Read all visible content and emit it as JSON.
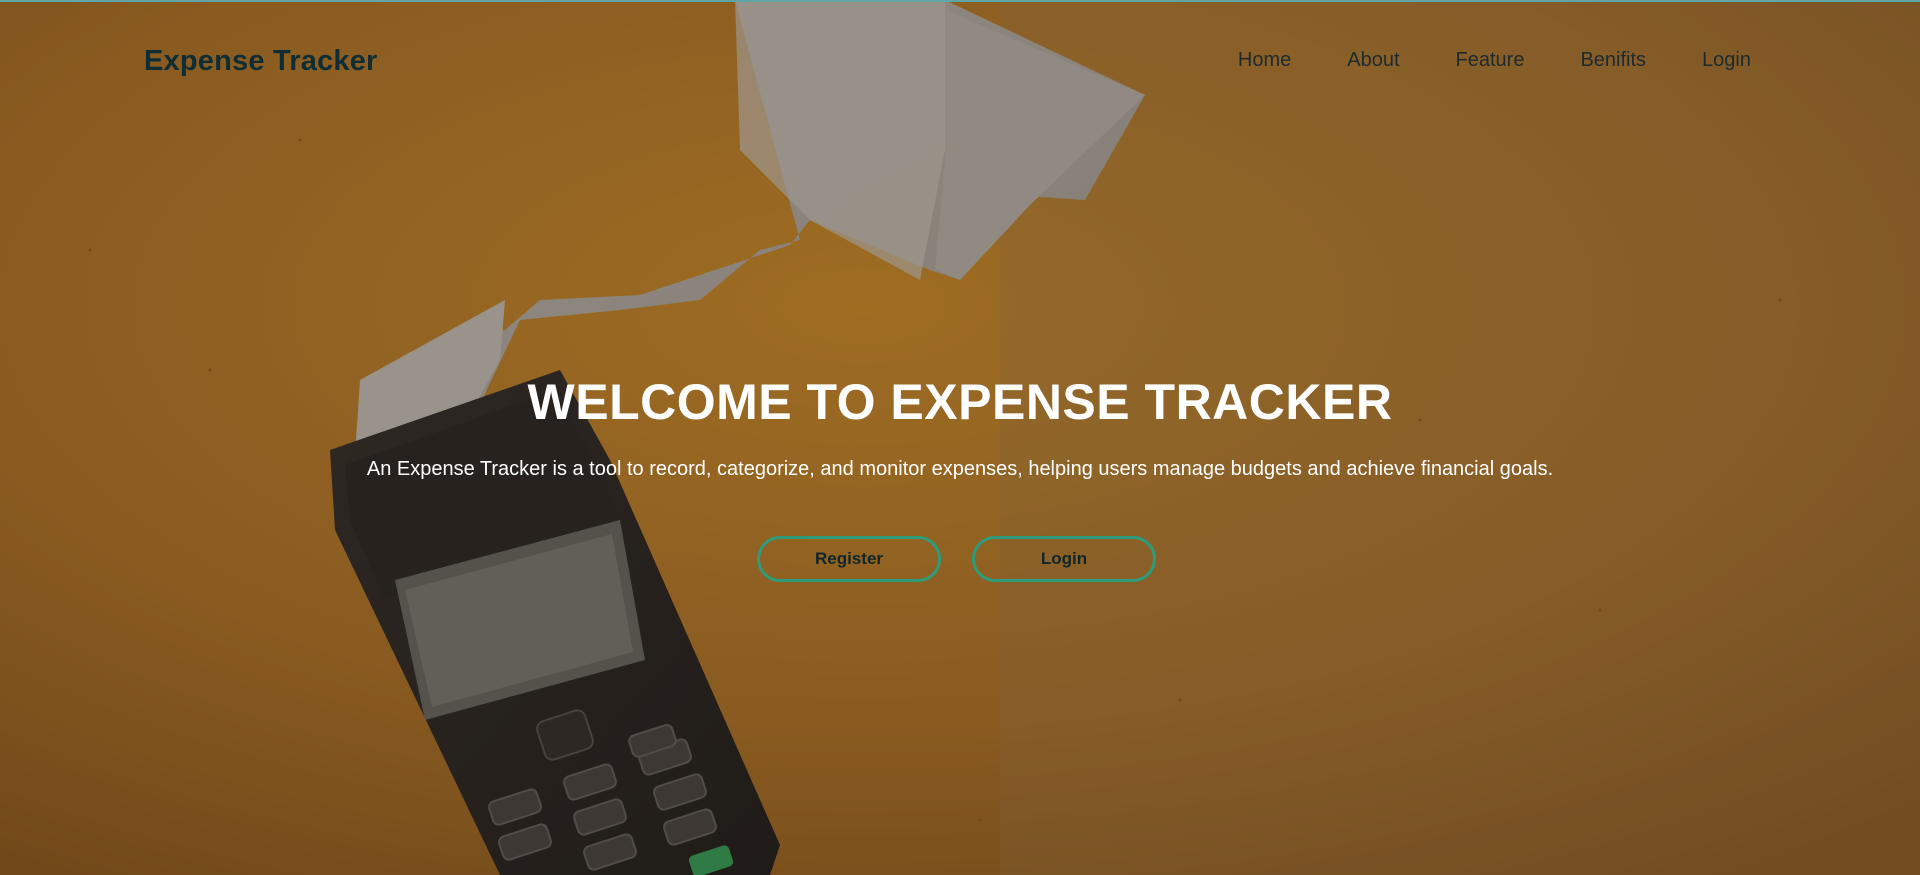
{
  "brand": {
    "name": "Expense Tracker"
  },
  "nav": {
    "items": [
      {
        "label": "Home"
      },
      {
        "label": "About"
      },
      {
        "label": "Feature"
      },
      {
        "label": "Benifits"
      },
      {
        "label": "Login"
      }
    ]
  },
  "hero": {
    "title": "WELCOME TO EXPENSE TRACKER",
    "description": "An Expense Tracker is a tool to record, categorize, and monitor expenses, helping users manage budgets and achieve financial goals.",
    "register_label": "Register",
    "login_label": "Login"
  },
  "colors": {
    "background": "#9a6420",
    "button_border": "#2e9c7a",
    "logo_text": "#0f2d33",
    "hero_text": "#ffffff"
  },
  "background_image": "orange-desk-card-terminal-receipt"
}
